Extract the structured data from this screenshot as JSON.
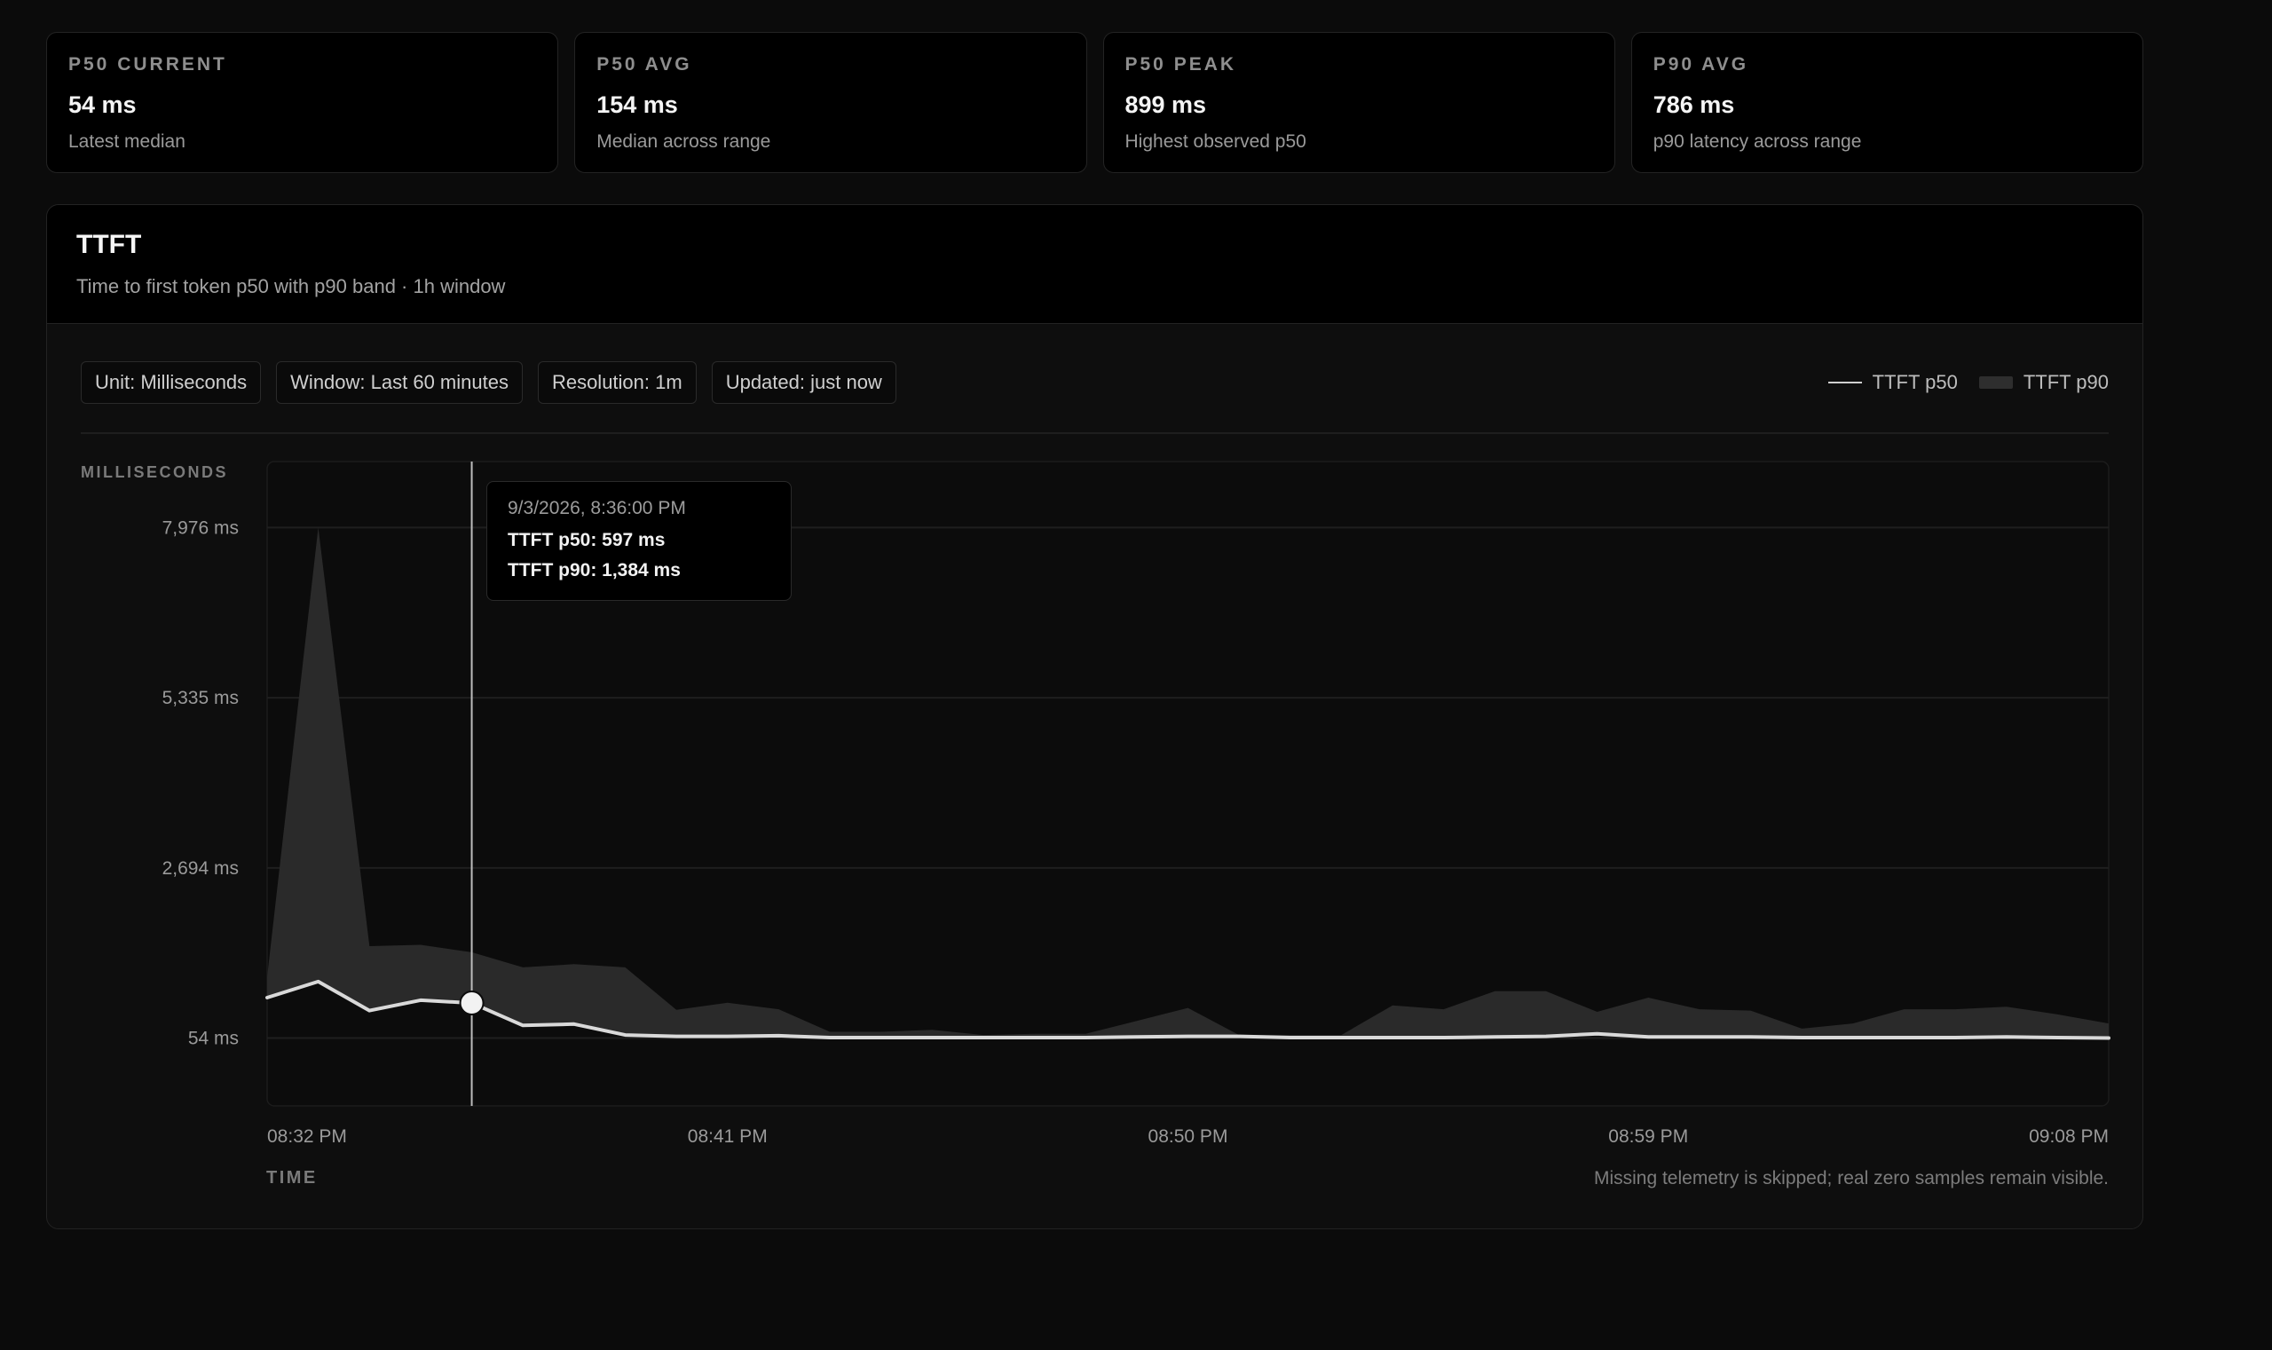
{
  "stats": [
    {
      "label": "P50 CURRENT",
      "value": "54 ms",
      "sub": "Latest median"
    },
    {
      "label": "P50 AVG",
      "value": "154 ms",
      "sub": "Median across range"
    },
    {
      "label": "P50 PEAK",
      "value": "899 ms",
      "sub": "Highest observed p50"
    },
    {
      "label": "P90 AVG",
      "value": "786 ms",
      "sub": "p90 latency across range"
    }
  ],
  "panel": {
    "title": "TTFT",
    "subtitle": "Time to first token p50 with p90 band · 1h window"
  },
  "chips": {
    "unit": "Unit: Milliseconds",
    "window": "Window: Last 60 minutes",
    "resolution": "Resolution: 1m",
    "updated": "Updated: just now"
  },
  "legend": {
    "p50": "TTFT p50",
    "p90": "TTFT p90"
  },
  "tooltip": {
    "time": "9/3/2026, 8:36:00 PM",
    "p50": "TTFT p50: 597 ms",
    "p90": "TTFT p90: 1,384 ms"
  },
  "footnote": "Missing telemetry is skipped; real zero samples remain visible.",
  "colors": {
    "p50_line": "#d9d9d9",
    "p90_band": "#2a2a2a",
    "grid": "#1f1f1f",
    "cursor": "#bdbdbd"
  },
  "chart_data": {
    "type": "area",
    "ylabel": "MILLISECONDS",
    "xlabel": "TIME",
    "ylim": [
      -1000,
      9000
    ],
    "y_ticks": [
      {
        "value": 54,
        "label": "54 ms"
      },
      {
        "value": 2694,
        "label": "2,694 ms"
      },
      {
        "value": 5335,
        "label": "5,335 ms"
      },
      {
        "value": 7976,
        "label": "7,976 ms"
      }
    ],
    "x_ticks": [
      "08:32 PM",
      "08:41 PM",
      "08:50 PM",
      "08:59 PM",
      "09:08 PM"
    ],
    "x_minutes": [
      0,
      1,
      2,
      3,
      4,
      5,
      6,
      7,
      8,
      9,
      10,
      11,
      12,
      13,
      14,
      15,
      16,
      17,
      18,
      19,
      20,
      21,
      22,
      23,
      24,
      25,
      26,
      27,
      28,
      29,
      30,
      31,
      32,
      33,
      34,
      35,
      36
    ],
    "cursor_index": 4,
    "grid": true,
    "legend": "top-right",
    "series": [
      {
        "name": "TTFT p50",
        "values": [
          680,
          930,
          480,
          640,
          597,
          250,
          270,
          100,
          80,
          80,
          90,
          60,
          60,
          60,
          60,
          60,
          60,
          70,
          80,
          80,
          60,
          60,
          60,
          60,
          70,
          80,
          120,
          70,
          70,
          70,
          60,
          60,
          60,
          60,
          70,
          60,
          54
        ]
      },
      {
        "name": "TTFT p90",
        "values": [
          1000,
          7976,
          1480,
          1500,
          1384,
          1150,
          1200,
          1150,
          490,
          600,
          500,
          150,
          150,
          180,
          100,
          120,
          120,
          320,
          520,
          100,
          100,
          100,
          560,
          500,
          780,
          780,
          460,
          680,
          500,
          480,
          200,
          280,
          500,
          500,
          540,
          420,
          280
        ]
      }
    ]
  }
}
